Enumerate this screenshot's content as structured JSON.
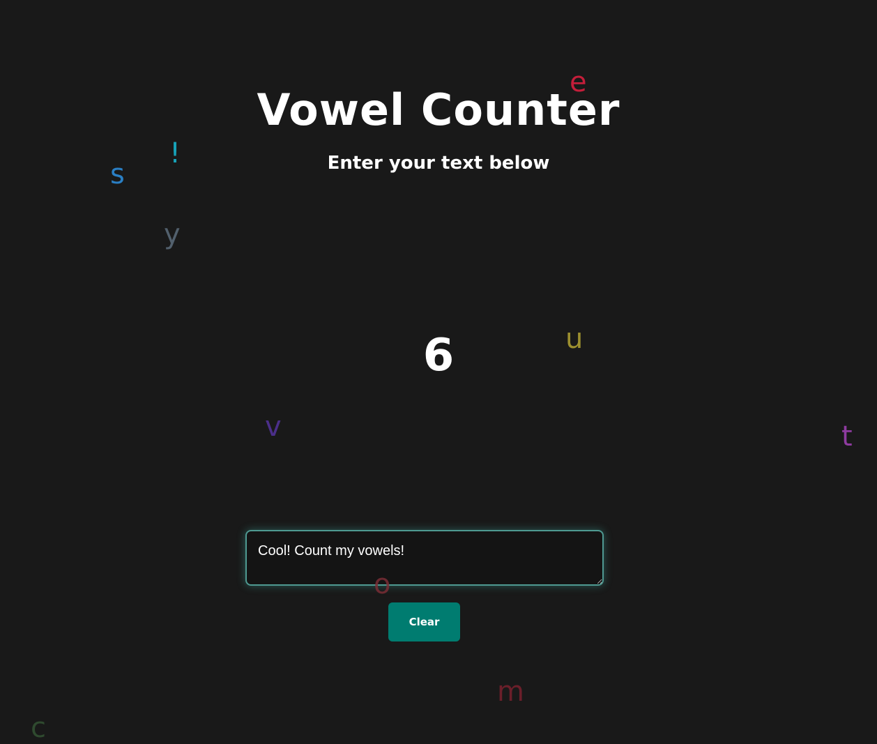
{
  "header": {
    "title": "Vowel Counter",
    "subtitle": "Enter your text below"
  },
  "result": {
    "vowel_count": "6"
  },
  "input": {
    "value": "Cool! Count my vowels!"
  },
  "actions": {
    "clear_label": "Clear"
  },
  "floating_letters": [
    {
      "char": "e",
      "color": "#c41e3a"
    },
    {
      "char": "!",
      "color": "#17a2b8"
    },
    {
      "char": "s",
      "color": "#2a7fc4"
    },
    {
      "char": "y",
      "color": "#52606d"
    },
    {
      "char": "u",
      "color": "#9c8f2f"
    },
    {
      "char": "v",
      "color": "#4b2f8a"
    },
    {
      "char": "t",
      "color": "#8e3ba0"
    },
    {
      "char": "o",
      "color": "#7a2d35"
    },
    {
      "char": "m",
      "color": "#6b1f2a"
    },
    {
      "char": "c",
      "color": "#2f4a2f"
    }
  ],
  "colors": {
    "background": "#191919",
    "accent": "#007c70",
    "input_border": "#4f9a92"
  }
}
